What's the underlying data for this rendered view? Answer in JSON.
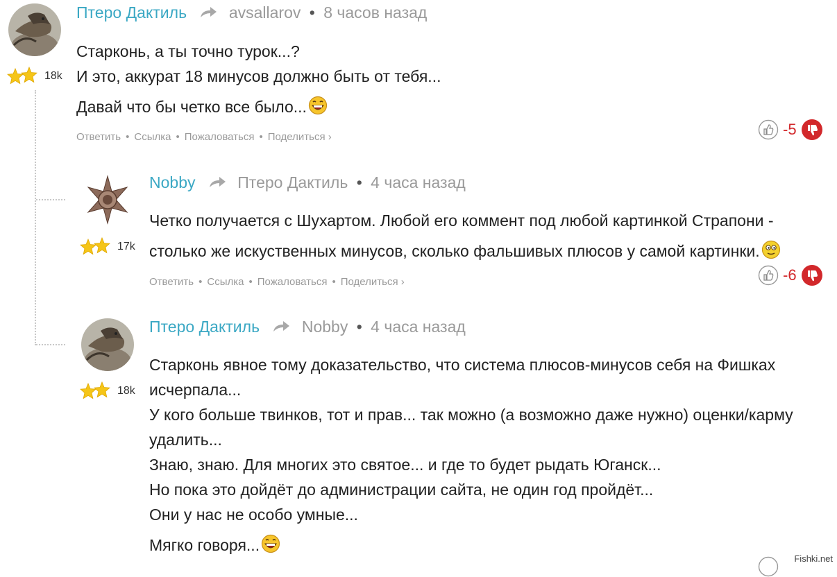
{
  "comments": [
    {
      "author": "Птеро Дактиль",
      "reply_to": "avsallarov",
      "time": "8 часов назад",
      "karma": "18k",
      "lines": [
        "Старконь, а ты точно турок...?",
        "И это, аккурат 18 минусов должно быть от тебя...",
        "Давай что бы четко все было..."
      ],
      "score": "-5"
    },
    {
      "author": "Nobby",
      "reply_to": "Птеро Дактиль",
      "time": "4 часа назад",
      "karma": "17k",
      "lines": [
        "Четко получается с Шухартом. Любой его коммент под любой картинкой Страпони -",
        "столько же искуственных минусов, сколько фальшивых плюсов у самой картинки."
      ],
      "score": "-6"
    },
    {
      "author": "Птеро Дактиль",
      "reply_to": "Nobby",
      "time": "4 часа назад",
      "karma": "18k",
      "lines": [
        "Старконь явное тому доказательство, что система плюсов-минусов себя на Фишках",
        "исчерпала...",
        "У кого больше твинков, тот и прав... так можно (а возможно даже нужно) оценки/карму",
        "удалить...",
        "Знаю, знаю. Для многих это святое... и где то будет рыдать Юганск...",
        "Но пока это дойдёт до администрации сайта, не один год пройдёт...",
        "Они у нас не особо умные...",
        "Мягко говоря..."
      ]
    }
  ],
  "actions": {
    "reply": "Ответить",
    "link": "Ссылка",
    "report": "Пожаловаться",
    "share": "Поделиться ›"
  },
  "separator": "•",
  "watermark": "Fishki.net",
  "colors": {
    "author": "#3ba8c4",
    "muted": "#9a9a9a",
    "negative": "#d2282b"
  },
  "icons": [
    "reply-arrow-icon",
    "star-rank-icon",
    "thumb-up-icon",
    "thumb-down-icon",
    "laughing-smiley-icon",
    "wink-smiley-icon"
  ]
}
